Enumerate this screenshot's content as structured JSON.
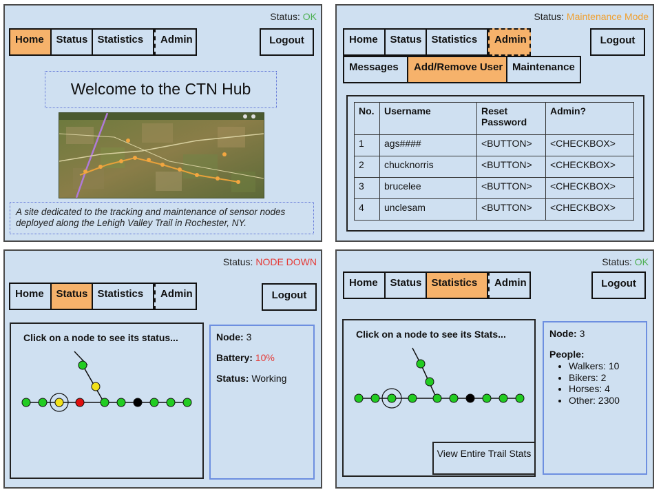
{
  "panels": {
    "home": {
      "status_label": "Status:",
      "status_value": "OK",
      "status_color": "#4caf50",
      "nav": [
        "Home",
        "Status",
        "Statistics",
        "Admin"
      ],
      "logout": "Logout",
      "title": "Welcome to the CTN Hub",
      "description": "A site dedicated to the tracking and maintenance of sensor nodes deployed along the Lehigh Valley Trail in Rochester, NY."
    },
    "admin": {
      "status_label": "Status:",
      "status_value": "Maintenance Mode",
      "status_color": "#f0a030",
      "nav": [
        "Home",
        "Status",
        "Statistics",
        "Admin"
      ],
      "logout": "Logout",
      "subnav": [
        "Messages",
        "Add/Remove User",
        "Maintenance"
      ],
      "table_headers": [
        "No.",
        "Username",
        "Reset Password",
        "Admin?"
      ],
      "rows": [
        [
          "1",
          "ags####",
          "<BUTTON>",
          "<CHECKBOX>"
        ],
        [
          "2",
          "chucknorris",
          "<BUTTON>",
          "<CHECKBOX>"
        ],
        [
          "3",
          "brucelee",
          "<BUTTON>",
          "<CHECKBOX>"
        ],
        [
          "4",
          "unclesam",
          "<BUTTON>",
          "<CHECKBOX>"
        ]
      ]
    },
    "status": {
      "status_label": "Status:",
      "status_value": "NODE DOWN",
      "status_color": "#e53935",
      "nav": [
        "Home",
        "Status",
        "Statistics",
        "Admin"
      ],
      "logout": "Logout",
      "instruction": "Click on a node to see its status...",
      "node_label": "Node:",
      "node_value": "3",
      "battery_label": "Battery:",
      "battery_value": "10%",
      "battery_color": "#e53935",
      "status_field_label": "Status:",
      "status_field_value": "Working"
    },
    "stats": {
      "status_label": "Status:",
      "status_value": "OK",
      "status_color": "#4caf50",
      "nav": [
        "Home",
        "Status",
        "Statistics",
        "Admin"
      ],
      "logout": "Logout",
      "instruction": "Click on a node to see its Stats...",
      "node_label": "Node:",
      "node_value": "3",
      "people_label": "People:",
      "people": [
        "Walkers: 10",
        "Bikers: 2",
        "Horses: 4",
        "Other: 2300"
      ],
      "view_button": "View Entire Trail Stats"
    }
  },
  "colors": {
    "panel_bg": "#cfe0f1",
    "active_tab": "#f6b26b",
    "node_ok": "#22cc22",
    "node_warn": "#f2e21a",
    "node_down": "#e01010",
    "node_off": "#000000"
  }
}
